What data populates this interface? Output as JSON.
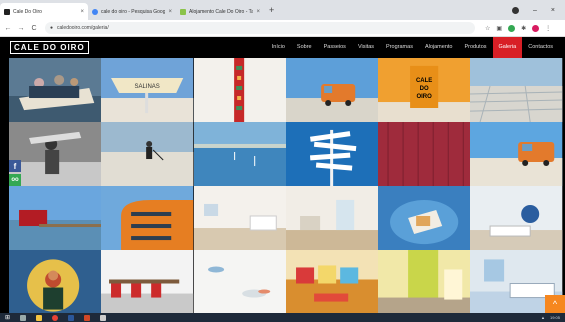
{
  "browser": {
    "tabs": [
      {
        "title": "Cale Do Oiro",
        "favicon_color": "#222222",
        "active": true
      },
      {
        "title": "cale do oiro - Pesquisa Google",
        "favicon_color": "#4285f4",
        "active": false
      },
      {
        "title": "Alojamento Cale Do Oiro - Tavira",
        "favicon_color": "#8bc34a",
        "active": false
      }
    ],
    "new_tab": "+",
    "close_glyph": "×",
    "url": "caledooiro.com/galeria/",
    "window_controls": [
      "–",
      "□",
      "×"
    ]
  },
  "site": {
    "logo": "CALE DO OIRO",
    "menu": [
      "Início",
      "Sobre",
      "Passeios",
      "Visitas",
      "Programas",
      "Alojamento",
      "Produtos",
      "Galeria",
      "Contactos"
    ],
    "active_menu": "Galeria",
    "accent": "#d81f26"
  },
  "gallery": {
    "photos": [
      {
        "name": "boat-harbour",
        "desc": "boat"
      },
      {
        "name": "salinas-banner",
        "desc": "banner"
      },
      {
        "name": "textile-pattern",
        "desc": "pattern"
      },
      {
        "name": "orange-van-salt",
        "desc": "van"
      },
      {
        "name": "orange-sign-cale",
        "desc": "sign"
      },
      {
        "name": "salt-pans-aerial",
        "desc": "saltpans"
      },
      {
        "name": "salt-worker-bw",
        "desc": "bw"
      },
      {
        "name": "salt-worker-field",
        "desc": "worker"
      },
      {
        "name": "ria-water",
        "desc": "water"
      },
      {
        "name": "directional-signs",
        "desc": "signs"
      },
      {
        "name": "red-wall",
        "desc": "redwall"
      },
      {
        "name": "orange-van-beach",
        "desc": "vanbeach"
      },
      {
        "name": "red-shed-pier",
        "desc": "shed"
      },
      {
        "name": "orange-building",
        "desc": "building"
      },
      {
        "name": "room-lobby",
        "desc": "room"
      },
      {
        "name": "room-corridor",
        "desc": "corridor"
      },
      {
        "name": "blue-table-book",
        "desc": "table"
      },
      {
        "name": "bedroom-art",
        "desc": "bedroom"
      },
      {
        "name": "tile-portrait",
        "desc": "portrait"
      },
      {
        "name": "dining-chairs",
        "desc": "dining"
      },
      {
        "name": "ceramic-fish",
        "desc": "fish"
      },
      {
        "name": "cushions-sofa",
        "desc": "cushions"
      },
      {
        "name": "yellow-room",
        "desc": "yellowroom"
      },
      {
        "name": "blue-bedroom",
        "desc": "bluebed"
      }
    ]
  },
  "social": [
    "f",
    "oo"
  ],
  "scroll_top": "^",
  "taskbar": {
    "time": "19:05"
  }
}
